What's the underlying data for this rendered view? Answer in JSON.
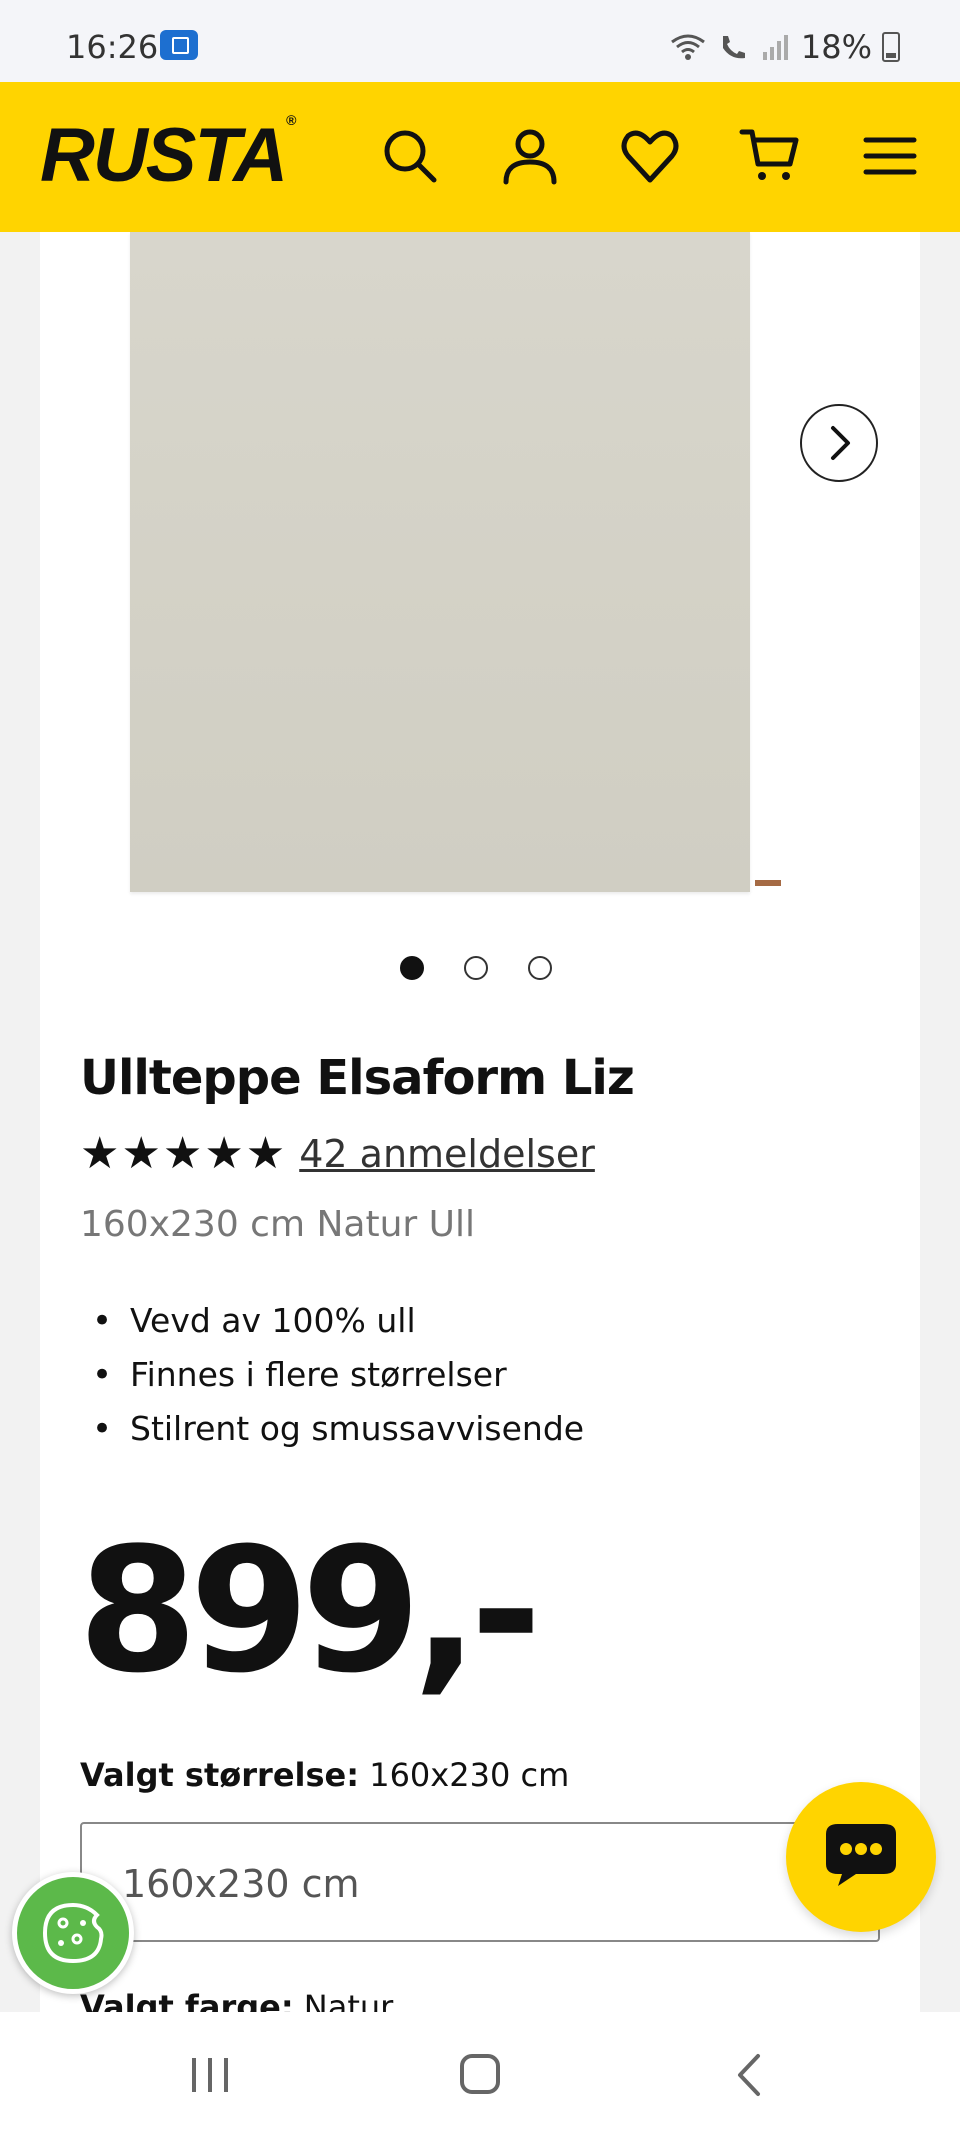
{
  "status_bar": {
    "time": "16:26",
    "battery": "18%",
    "icons": [
      "app-notification-icon",
      "wifi-icon",
      "call-icon",
      "signal-icon",
      "battery-icon"
    ]
  },
  "header": {
    "logo": "RUSTA",
    "logo_mark": "®",
    "background": "#ffd400",
    "icons": [
      "search-icon",
      "account-icon",
      "heart-icon",
      "cart-icon",
      "menu-icon"
    ]
  },
  "product": {
    "title": "Ullteppe Elsaform Liz",
    "stars_display": "★★★★★",
    "rating_value": 4.8,
    "reviews_label": "42 anmeldelser",
    "variant": "160x230 cm Natur Ull",
    "features": [
      "Vevd av 100% ull",
      "Finnes i flere størrelser",
      "Stilrent og smussavvisende"
    ],
    "price": "899,-"
  },
  "gallery": {
    "image_count": 3,
    "active_index": 0
  },
  "size": {
    "label": "Valgt størrelse:",
    "value": "160x230 cm",
    "selected_option": "160x230 cm"
  },
  "color": {
    "label": "Valgt farge:",
    "value": "Natur"
  },
  "nav": {
    "items": [
      "recent-apps-icon",
      "home-icon",
      "back-icon"
    ]
  }
}
